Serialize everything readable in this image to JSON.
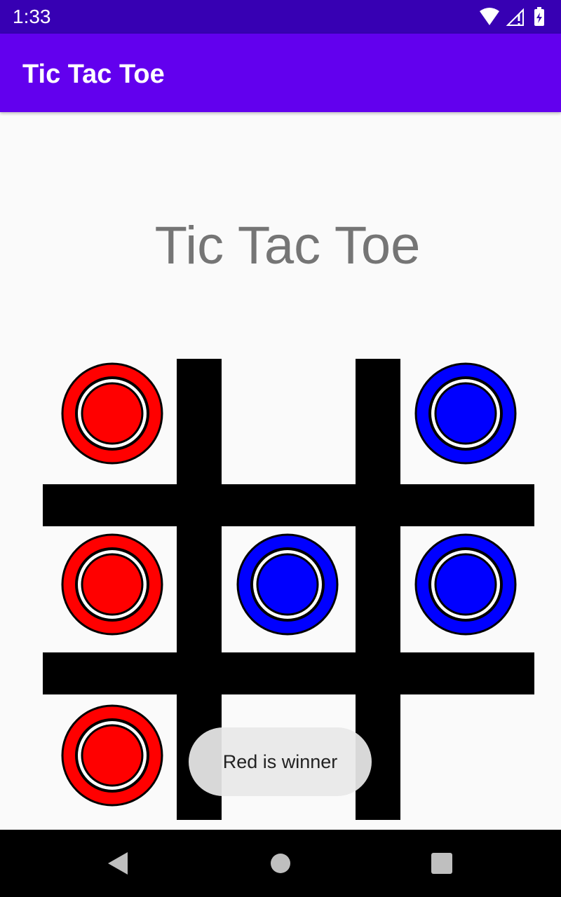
{
  "status_bar": {
    "time": "1:33",
    "icons": [
      "wifi-icon",
      "cell-signal-icon",
      "battery-charging-icon"
    ]
  },
  "app_bar": {
    "title": "Tic Tac Toe"
  },
  "heading": "Tic Tac Toe",
  "board": {
    "cells": [
      "red",
      "empty",
      "blue",
      "red",
      "blue",
      "blue",
      "red",
      "empty",
      "empty"
    ],
    "colors": {
      "red": "#ff0000",
      "blue": "#0000ff",
      "line": "#000000"
    }
  },
  "toast": {
    "message": "Red is winner"
  },
  "nav_bar": {
    "buttons": [
      "back-icon",
      "home-icon",
      "recents-icon"
    ]
  },
  "theme": {
    "status_bar": "#3700b3",
    "primary": "#6200ee"
  }
}
